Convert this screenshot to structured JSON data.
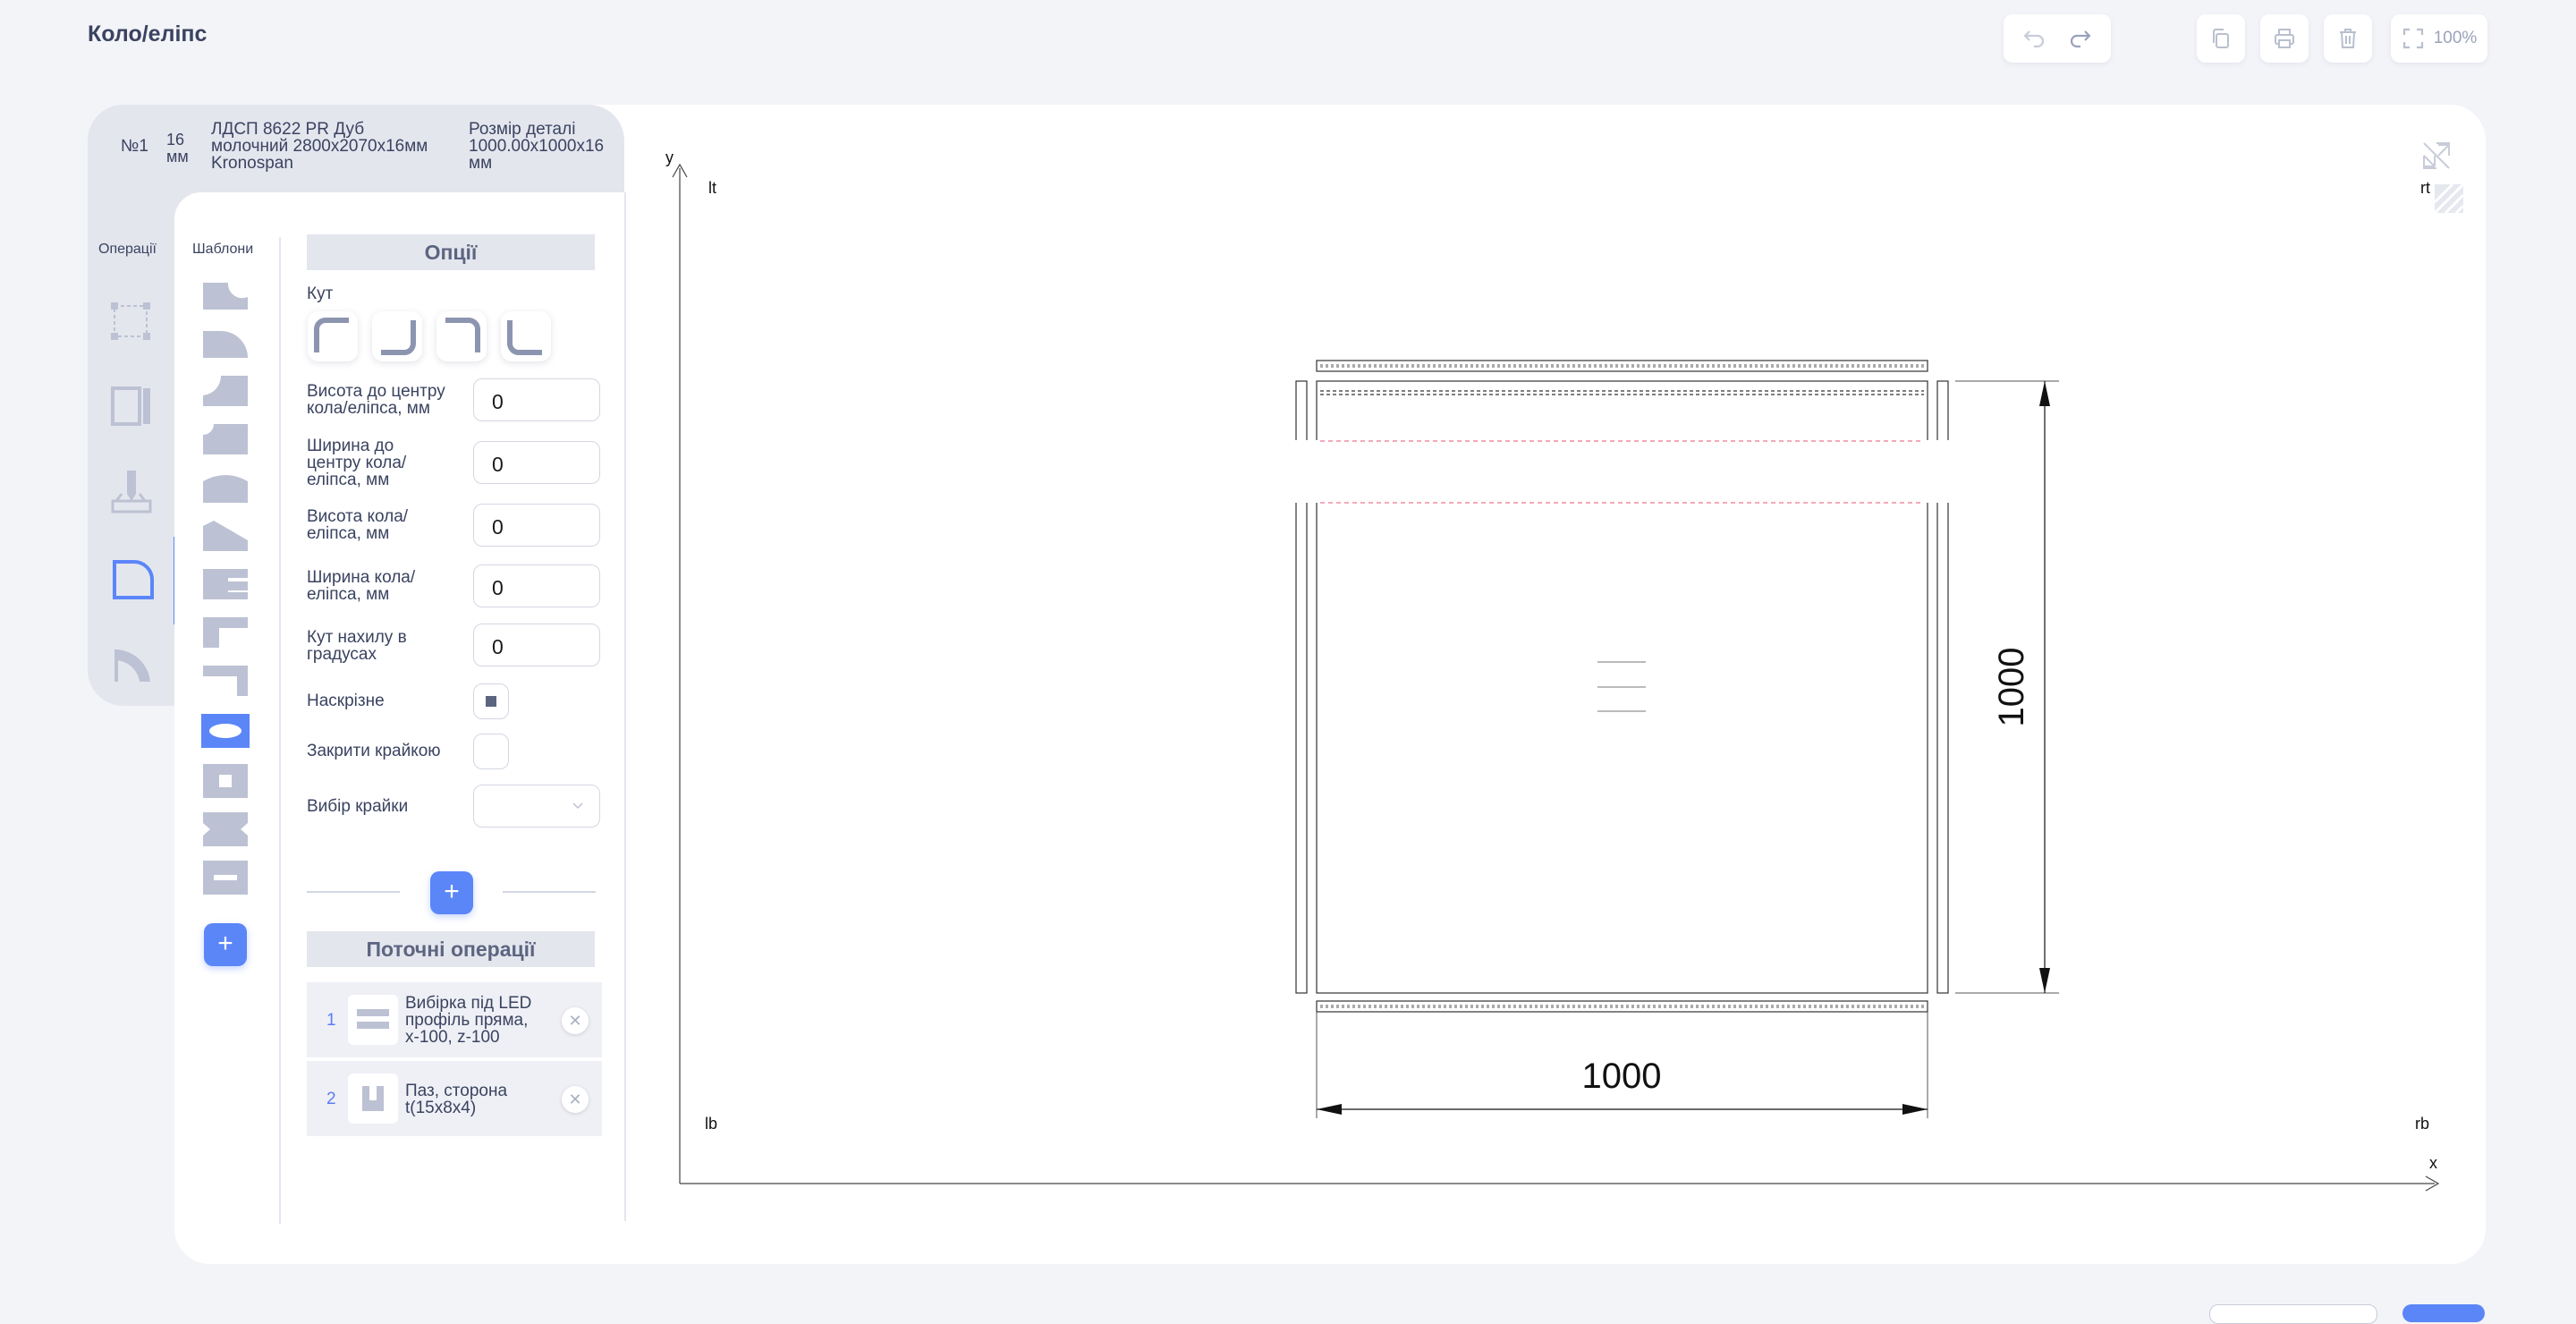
{
  "header": {
    "title": "Коло/еліпс"
  },
  "toolbar": {
    "undo_icon": "undo-icon",
    "redo_icon": "redo-icon",
    "copy_icon": "copy-icon",
    "print_icon": "print-icon",
    "delete_icon": "trash-icon",
    "fullscreen_icon": "fullscreen-icon",
    "zoom": "100%"
  },
  "part": {
    "number": "№1",
    "thickness_line1": "16",
    "thickness_line2": "мм",
    "material_line1": "ЛДСП 8622 PR Дуб",
    "material_line2": "молочний 2800x2070x16мм",
    "material_line3": "Kronospan",
    "size_label": "Розмір деталі",
    "size_line1": "1000.00x1000x16",
    "size_line2": "мм"
  },
  "tabs": {
    "operations": "Операції",
    "templates": "Шаблони"
  },
  "options": {
    "header": "Опції",
    "angle_label": "Кут",
    "fields": [
      {
        "label_l1": "Висота до центру",
        "label_l2": "кола/еліпса, мм",
        "label_l3": "",
        "value": "0"
      },
      {
        "label_l1": "Ширина до",
        "label_l2": "центру кола/",
        "label_l3": "еліпса, мм",
        "value": "0"
      },
      {
        "label_l1": "Висота кола/",
        "label_l2": "еліпса, мм",
        "label_l3": "",
        "value": "0"
      },
      {
        "label_l1": "Ширина кола/",
        "label_l2": "еліпса, мм",
        "label_l3": "",
        "value": "0"
      },
      {
        "label_l1": "Кут нахилу в",
        "label_l2": "градусах",
        "label_l3": "",
        "value": "0"
      }
    ],
    "through_label": "Наскрізне",
    "through_checked": true,
    "close_edge_label": "Закрити крайкою",
    "close_edge_checked": false,
    "edge_select_label": "Вибір крайки",
    "edge_select_value": "",
    "add_button": "+"
  },
  "current_ops": {
    "header": "Поточні операції",
    "items": [
      {
        "num": "1",
        "l1": "Вибірка під LED",
        "l2": "профіль пряма,",
        "l3": "x-100, z-100"
      },
      {
        "num": "2",
        "l1": "Паз, сторона",
        "l2": "t(15x8x4)",
        "l3": ""
      }
    ]
  },
  "templates_add": "+",
  "drawing": {
    "axis_x": "x",
    "axis_y": "y",
    "corner_lt": "lt",
    "corner_rt": "rt",
    "corner_lb": "lb",
    "corner_rb": "rb",
    "dim_width": "1000",
    "dim_height": "1000"
  }
}
